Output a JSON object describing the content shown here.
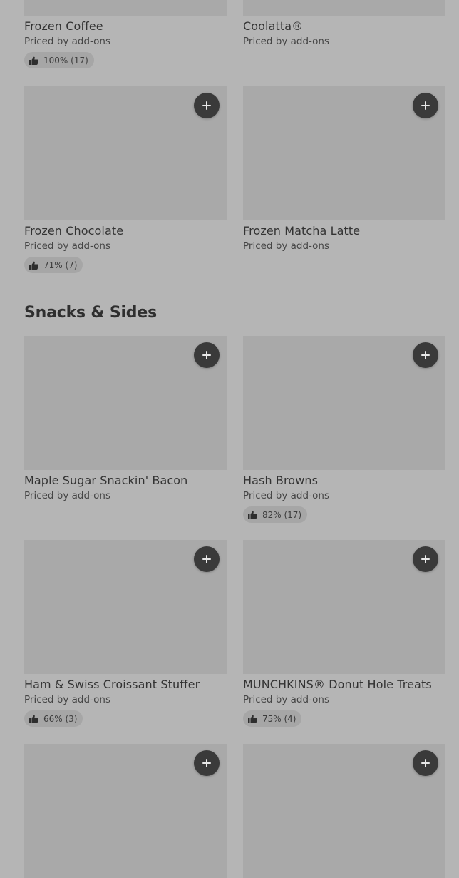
{
  "items": [
    {
      "name": "Frozen Coffee",
      "price": "Priced by add-ons",
      "rating": "100% (17)"
    },
    {
      "name": "Coolatta®",
      "price": "Priced by add-ons"
    },
    {
      "name": "Frozen Chocolate",
      "price": "Priced by add-ons",
      "rating": "71% (7)"
    },
    {
      "name": "Frozen Matcha Latte",
      "price": "Priced by add-ons"
    }
  ],
  "section": {
    "title": "Snacks & Sides",
    "items": [
      {
        "name": "Maple Sugar Snackin' Bacon",
        "price": "Priced by add-ons"
      },
      {
        "name": "Hash Browns",
        "price": "Priced by add-ons",
        "rating": "82% (17)"
      },
      {
        "name": "Ham & Swiss Croissant Stuffer",
        "price": "Priced by add-ons",
        "rating": "66% (3)"
      },
      {
        "name": "MUNCHKINS® Donut Hole Treats",
        "price": "Priced by add-ons",
        "rating": "75% (4)"
      }
    ]
  },
  "icons": {
    "add": "plus-icon",
    "rating": "thumbs-up-icon"
  },
  "colors": {
    "background": "#b5b5b5",
    "image_placeholder": "#a9a9a9",
    "add_button": "#3a3a3a",
    "rating_pill": "#a6a6a6"
  }
}
